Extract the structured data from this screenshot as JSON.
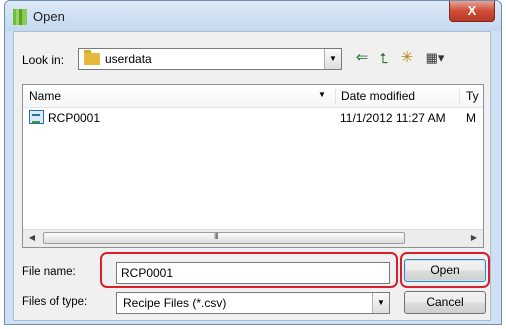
{
  "window": {
    "title": "Open",
    "close_glyph": "X"
  },
  "lookin": {
    "label": "Look in:",
    "value": "userdata",
    "dropdown_glyph": "▼"
  },
  "toolbar": {
    "back_glyph": "⇐",
    "up_glyph": "⮤",
    "newfolder_glyph": "✳",
    "views_glyph": "▦▾"
  },
  "list": {
    "headers": {
      "name": "Name",
      "sort_glyph": "▼",
      "date": "Date modified",
      "type": "Ty"
    },
    "rows": [
      {
        "name": "RCP0001",
        "date": "11/1/2012 11:27 AM",
        "type": "M"
      }
    ],
    "scroll": {
      "left_glyph": "◀",
      "right_glyph": "▶",
      "grip": "III"
    }
  },
  "filename": {
    "label": "File name:",
    "value": "RCP0001"
  },
  "filetype": {
    "label": "Files of type:",
    "value": "Recipe Files (*.csv)",
    "dropdown_glyph": "▼"
  },
  "buttons": {
    "open": "Open",
    "cancel": "Cancel"
  },
  "highlight_color": "#d6202e"
}
